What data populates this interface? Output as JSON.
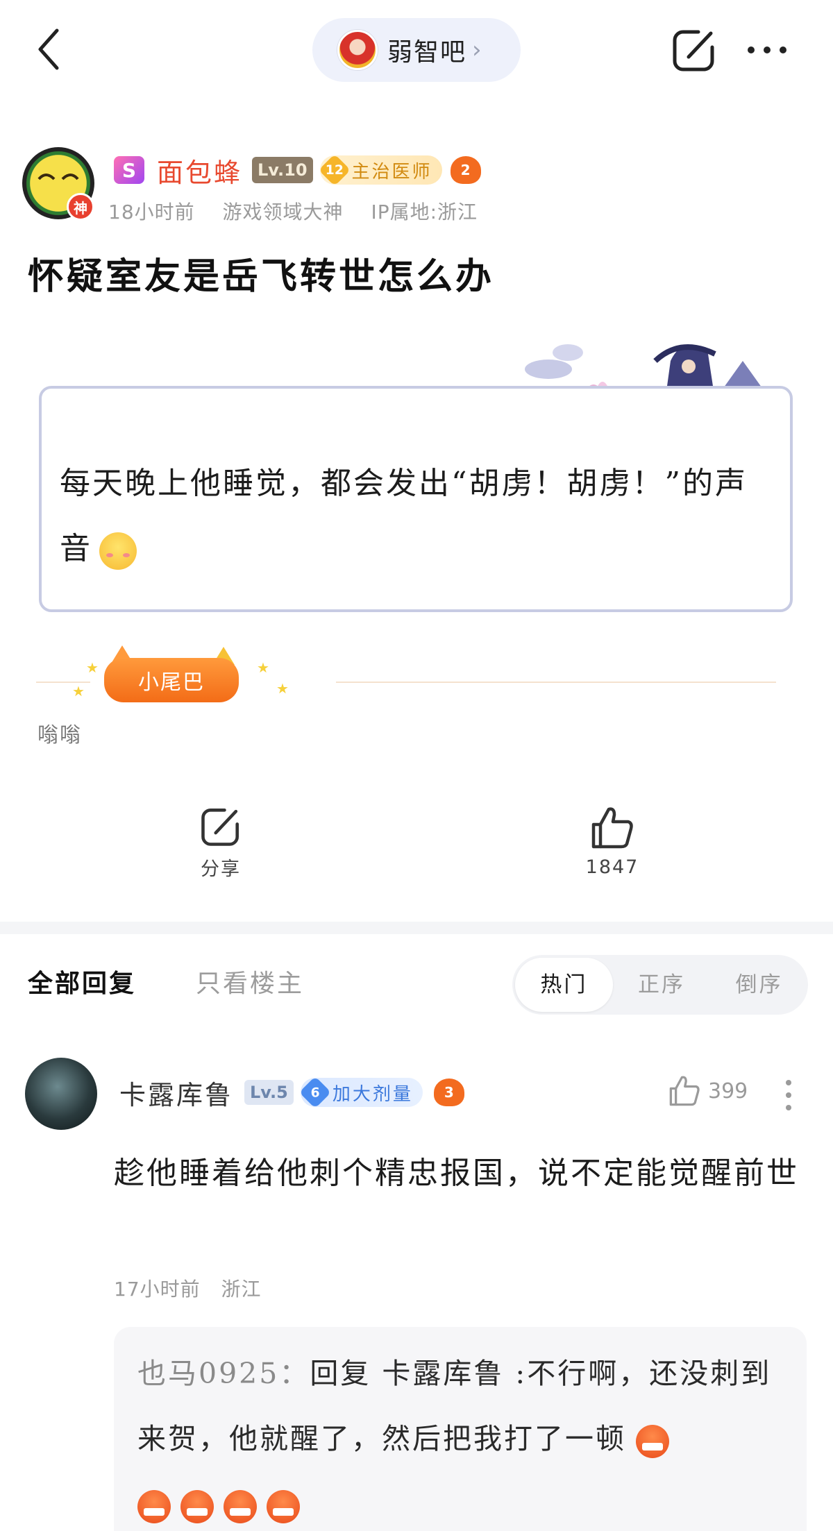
{
  "topbar": {
    "forum_name": "弱智吧",
    "forum_chevron": "›",
    "back_icon": "chevron-left-icon",
    "share_icon": "share-icon",
    "more_icon": "more-dots-icon"
  },
  "author": {
    "vip_letter": "S",
    "name": "面包蜂",
    "level": "Lv.10",
    "title_level": "12",
    "title_text": "主治医师",
    "medal": "2",
    "god_badge": "神",
    "time": "18小时前",
    "honor": "游戏领域大神",
    "ip": "IP属地:浙江"
  },
  "post": {
    "title": "怀疑室友是岳飞转世怎么办",
    "body": "每天晚上他睡觉，都会发出“胡虏！胡虏！”的声音"
  },
  "tail": {
    "badge": "小尾巴",
    "text": "嗡嗡"
  },
  "actions": {
    "share_label": "分享",
    "like_count": "1847"
  },
  "reply_tabs": {
    "all": "全部回复",
    "op_only": "只看楼主",
    "sort": [
      "热门",
      "正序",
      "倒序"
    ],
    "active_sort": "热门"
  },
  "comment": {
    "name": "卡露库鲁",
    "level": "Lv.5",
    "title_level": "6",
    "title_text": "加大剂量",
    "medal": "3",
    "likes": "399",
    "body": "趁他睡着给他刺个精忠报国，说不定能觉醒前世",
    "time": "17小时前",
    "location": "浙江",
    "sub_reply": {
      "user": "也马0925：",
      "text": "回复 卡露库鲁 :不行啊，还没刺到来贺，他就醒了，然后把我打了一顿"
    }
  },
  "colors": {
    "author_name": "#e8492f",
    "accent_orange": "#f36c17",
    "card_border": "#c7cbe3",
    "title_badge_blue": "#3b78dc"
  }
}
